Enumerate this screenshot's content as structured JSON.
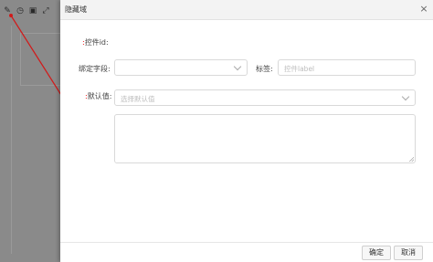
{
  "modal": {
    "title": "隐藏域",
    "close_icon": "×",
    "fields": {
      "control_id_label": "控件id:",
      "bind_field_label": "绑定字段:",
      "bind_field_value": "",
      "label_label": "标签:",
      "label_placeholder": "控件label",
      "default_label": "默认值:",
      "default_placeholder": "选择默认值",
      "textarea_value": ""
    },
    "footer": {
      "confirm_label": "确定",
      "cancel_label": "取消"
    }
  },
  "toolbar": {
    "icons": [
      "edit-icon",
      "clock-icon",
      "save-icon",
      "expand-icon"
    ]
  },
  "colors": {
    "overlay": "#8a8a8a",
    "arrow": "#d11a1a"
  }
}
